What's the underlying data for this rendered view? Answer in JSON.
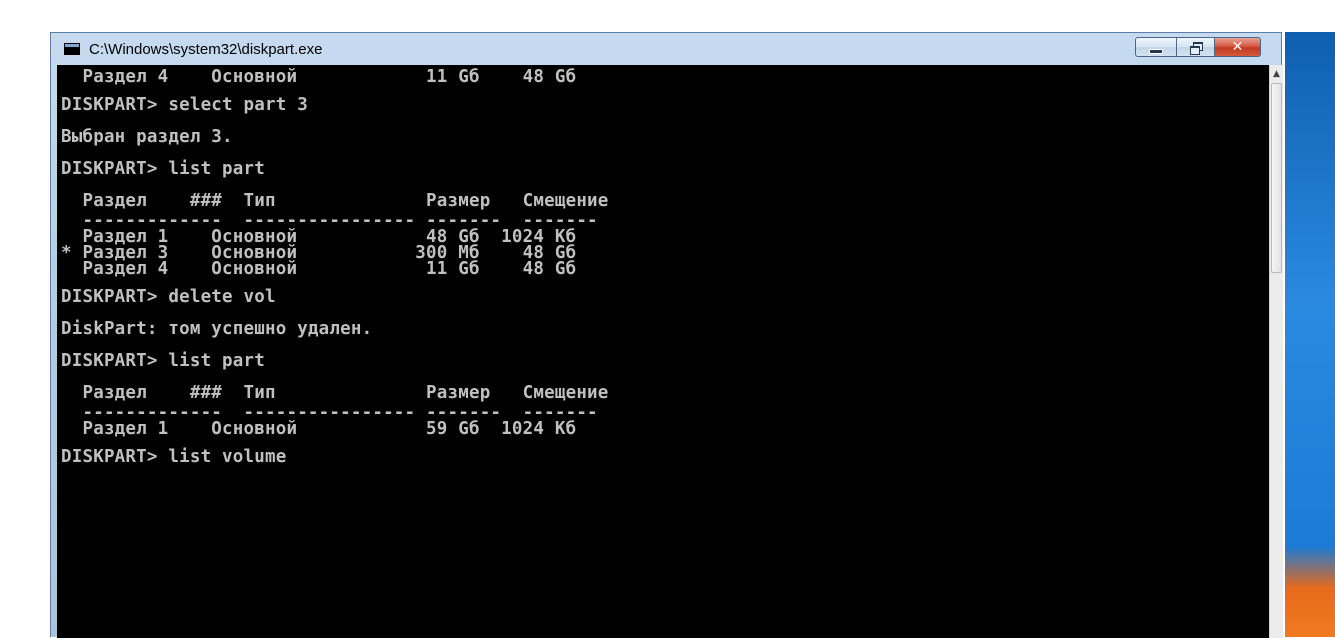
{
  "window": {
    "title": "C:\\Windows\\system32\\diskpart.exe",
    "minimize_glyph": "",
    "close_glyph": "✕"
  },
  "console": {
    "lines": [
      "  Раздел 4    Основной            11 Gб    48 Gб",
      "",
      "DISKPART> select part 3",
      "",
      "Выбран раздел 3.",
      "",
      "DISKPART> list part",
      "",
      "  Раздел    ###  Тип              Размер   Смещение",
      "  -------------  ---------------- -------  -------",
      "  Раздел 1    Основной            48 Gб  1024 Kб",
      "* Раздел 3    Основной           300 Mб    48 Gб",
      "  Раздел 4    Основной            11 Gб    48 Gб",
      "",
      "DISKPART> delete vol",
      "",
      "DiskPart: том успешно удален.",
      "",
      "DISKPART> list part",
      "",
      "  Раздел    ###  Тип              Размер   Смещение",
      "  -------------  ---------------- -------  -------",
      "  Раздел 1    Основной            59 Gб  1024 Kб",
      "",
      "DISKPART> list volume"
    ]
  },
  "scrollbar": {
    "up_arrow_icon": "triangle-up"
  }
}
